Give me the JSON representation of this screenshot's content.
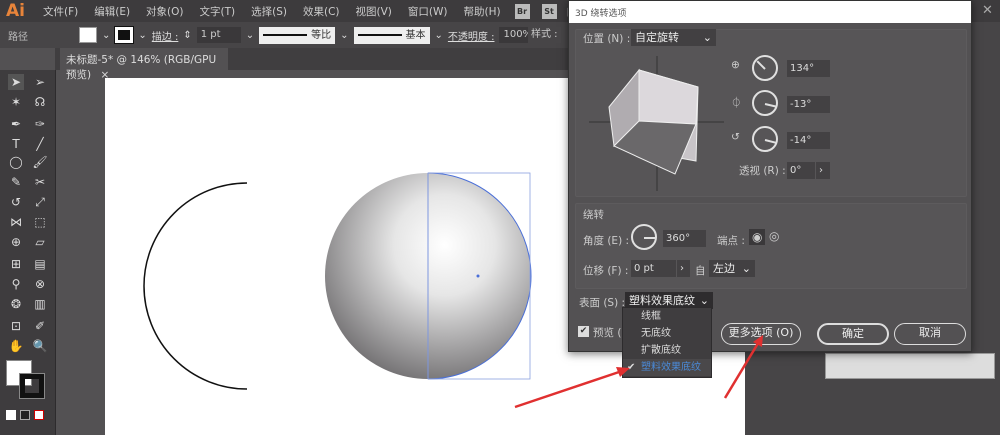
{
  "app": {
    "logo": "Ai",
    "menu": [
      "文件(F)",
      "编辑(E)",
      "对象(O)",
      "文字(T)",
      "选择(S)",
      "效果(C)",
      "视图(V)",
      "窗口(W)",
      "帮助(H)"
    ],
    "bridge": "Br",
    "stock": "St"
  },
  "control": {
    "object_type": "路径",
    "stroke_label": "描边 :",
    "stroke_weight": "1 pt",
    "profile1": "等比",
    "profile2": "基本",
    "opacity_label": "不透明度 :",
    "opacity": "100%",
    "style_label": "样式 :"
  },
  "document_tab": {
    "title": "未标题-5* @ 146% (RGB/GPU 预览)",
    "close": "×"
  },
  "dialog": {
    "title": "3D 绕转选项",
    "position_label": "位置 (N) :",
    "position_value": "自定旋转",
    "rot_x": "134°",
    "rot_y": "-13°",
    "rot_z": "-14°",
    "perspective_label": "透视 (R) :",
    "perspective": "0°",
    "revolve_section": "绕转",
    "angle_label": "角度 (E) :",
    "angle": "360°",
    "cap_label": "端点 :",
    "offset_label": "位移 (F) :",
    "offset": "0 pt",
    "from_label": "自",
    "from_value": "左边",
    "surface_label": "表面 (S) :",
    "surface_value": "塑料效果底纹",
    "surface_options": [
      "线框",
      "无底纹",
      "扩散底纹",
      "塑料效果底纹"
    ],
    "preview_label": "预览 (P",
    "more_options": "更多选项 (O)",
    "ok": "确定",
    "cancel": "取消"
  },
  "colors": {
    "accent": "#4a8ad8",
    "selection": "#4a6fd8",
    "arrow": "#e03030"
  }
}
